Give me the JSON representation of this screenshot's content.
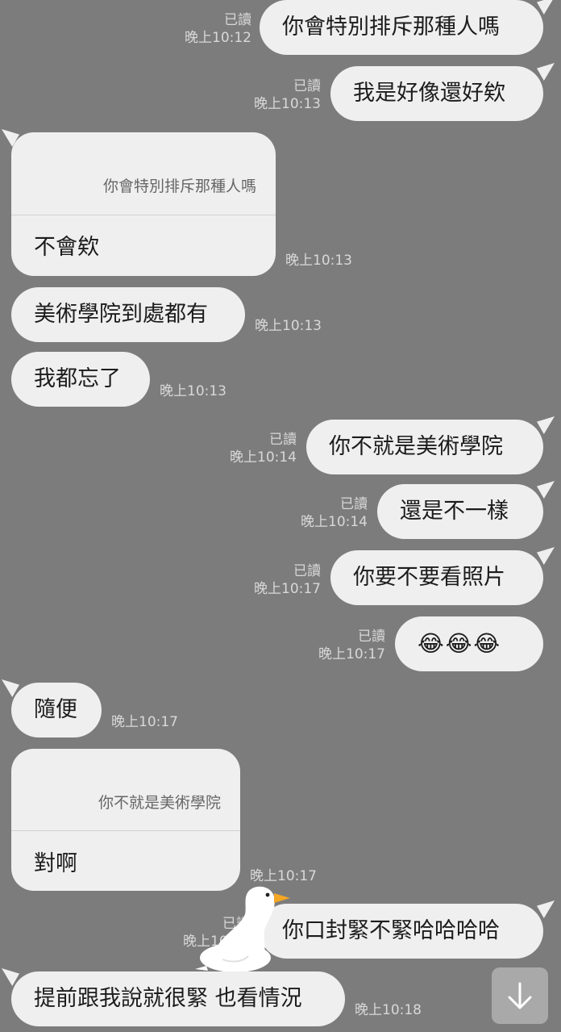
{
  "read_label": "已讀",
  "messages": [
    {
      "text": "你會特別排斥那種人嗎",
      "time": "晚上10:12"
    },
    {
      "text": "我是好像還好欸",
      "time": "晚上10:13"
    },
    {
      "quote": "你會特別排斥那種人嗎",
      "text": "不會欸",
      "time": "晚上10:13"
    },
    {
      "text": "美術學院到處都有",
      "time": "晚上10:13"
    },
    {
      "text": "我都忘了",
      "time": "晚上10:13"
    },
    {
      "text": "你不就是美術學院",
      "time": "晚上10:14"
    },
    {
      "text": "還是不一樣",
      "time": "晚上10:14"
    },
    {
      "text": "你要不要看照片",
      "time": "晚上10:17"
    },
    {
      "text": "😂😂😂",
      "time": "晚上10:17"
    },
    {
      "text": "隨便",
      "time": "晚上10:17"
    },
    {
      "quote": "你不就是美術學院",
      "text": "對啊",
      "time": "晚上10:17"
    },
    {
      "text": "你口封緊不緊哈哈哈哈",
      "time": "晚上10:18"
    },
    {
      "text": "提前跟我說就很緊 也看情況",
      "time": "晚上10:18"
    }
  ],
  "icons": {
    "scroll_down": "arrow-down-icon",
    "sticker": "duck-sticker"
  }
}
